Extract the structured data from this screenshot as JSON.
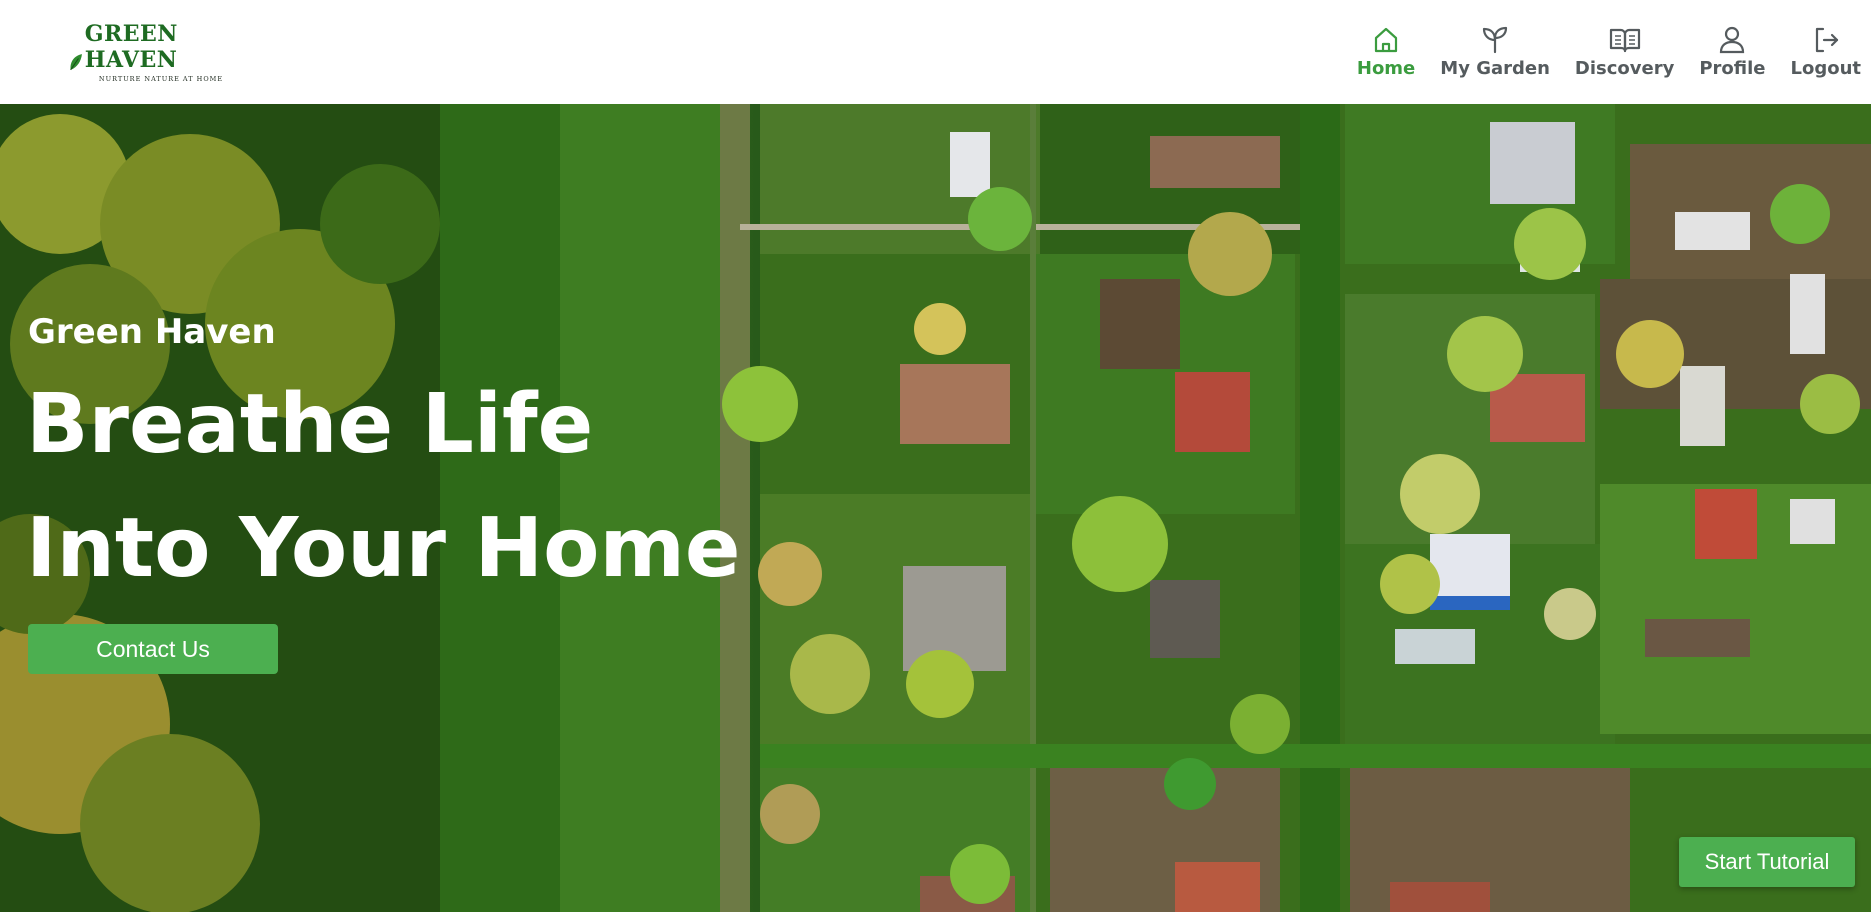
{
  "brand": {
    "name": "Green Haven",
    "logo_letters": "GREEN HAVEN",
    "tagline": "NURTURE NATURE AT HOME"
  },
  "nav": {
    "items": [
      {
        "label": "Home",
        "icon": "home-icon",
        "active": true
      },
      {
        "label": "My Garden",
        "icon": "sprout-icon",
        "active": false
      },
      {
        "label": "Discovery",
        "icon": "book-icon",
        "active": false
      },
      {
        "label": "Profile",
        "icon": "user-icon",
        "active": false
      },
      {
        "label": "Logout",
        "icon": "logout-icon",
        "active": false
      }
    ]
  },
  "hero": {
    "subtitle": "Green Haven",
    "headline_line1": "Breathe Life",
    "headline_line2": "Into Your Home",
    "contact_label": "Contact Us",
    "tutorial_label": "Start Tutorial",
    "background": "aerial photo of allotment gardens"
  },
  "colors": {
    "accent": "#4caf50",
    "active_nav": "#3b9c3f",
    "nav_text": "#555b5e",
    "logo_green": "#1e6b22"
  }
}
